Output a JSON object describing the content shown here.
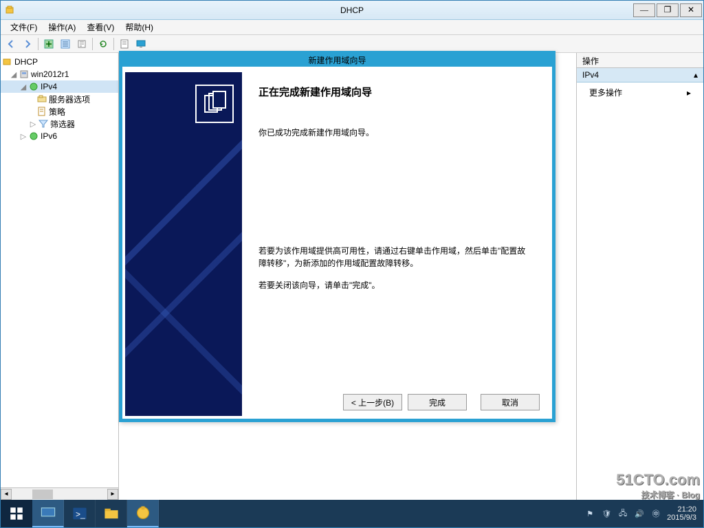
{
  "window": {
    "title": "DHCP"
  },
  "menu": {
    "file": "文件(F)",
    "action": "操作(A)",
    "view": "查看(V)",
    "help": "帮助(H)"
  },
  "tree": {
    "root": "DHCP",
    "server": "win2012r1",
    "ipv4": "IPv4",
    "server_options": "服务器选项",
    "policies": "策略",
    "filters": "筛选器",
    "ipv6": "IPv6"
  },
  "actions": {
    "header": "操作",
    "section": "IPv4",
    "more": "更多操作"
  },
  "dialog": {
    "title": "新建作用域向导",
    "heading": "正在完成新建作用域向导",
    "line1": "你已成功完成新建作用域向导。",
    "line2": "若要为该作用域提供高可用性，请通过右键单击作用域，然后单击\"配置故障转移\"，为新添加的作用域配置故障转移。",
    "line3": "若要关闭该向导，请单击\"完成\"。",
    "back": "< 上一步(B)",
    "finish": "完成",
    "cancel": "取消"
  },
  "taskbar": {
    "time": "21:20",
    "date": "2015/9/3"
  },
  "watermark": {
    "main": "51CTO.com",
    "sub": "技术博客 · Blog"
  }
}
